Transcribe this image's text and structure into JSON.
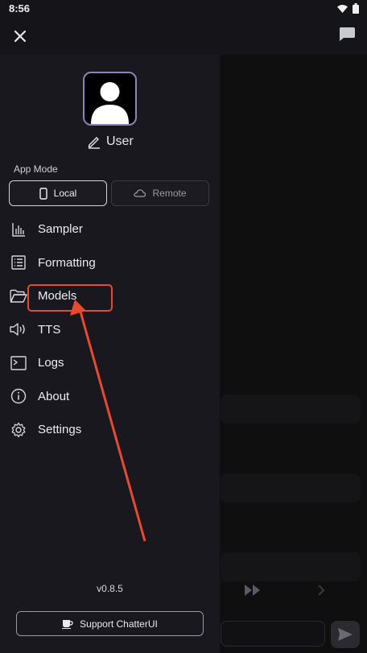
{
  "status_bar": {
    "time": "8:56"
  },
  "drawer": {
    "user_name": "User",
    "app_mode_label": "App Mode",
    "modes": [
      {
        "label": "Local",
        "icon": "phone-icon",
        "selected": true
      },
      {
        "label": "Remote",
        "icon": "cloud-icon",
        "selected": false
      }
    ],
    "nav_items": [
      {
        "label": "Sampler",
        "icon": "bar-chart-icon"
      },
      {
        "label": "Formatting",
        "icon": "list-icon"
      },
      {
        "label": "Models",
        "icon": "folder-icon"
      },
      {
        "label": "TTS",
        "icon": "speaker-icon"
      },
      {
        "label": "Logs",
        "icon": "terminal-icon"
      },
      {
        "label": "About",
        "icon": "info-icon"
      },
      {
        "label": "Settings",
        "icon": "gear-icon"
      }
    ],
    "version": "v0.8.5",
    "support_button_label": "Support ChatterUI"
  },
  "annotation": {
    "color": "#e84a30",
    "highlighted_item": "Models"
  },
  "colors": {
    "drawer_bg": "#19181f",
    "accent_border": "#8a84b8"
  }
}
